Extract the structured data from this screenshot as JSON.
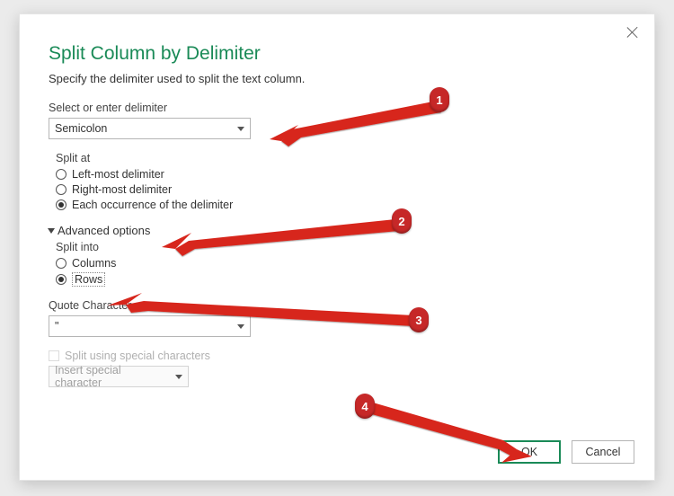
{
  "dialog": {
    "title": "Split Column by Delimiter",
    "subtitle": "Specify the delimiter used to split the text column."
  },
  "delimiter": {
    "label": "Select or enter delimiter",
    "value": "Semicolon"
  },
  "split_at": {
    "heading": "Split at",
    "options": {
      "left": "Left-most delimiter",
      "right": "Right-most delimiter",
      "each": "Each occurrence of the delimiter"
    },
    "selected": "each"
  },
  "advanced": {
    "toggle": "Advanced options",
    "split_into": {
      "heading": "Split into",
      "options": {
        "columns": "Columns",
        "rows": "Rows"
      },
      "selected": "rows"
    },
    "quote": {
      "label": "Quote Character",
      "value": "\""
    },
    "special": {
      "checkbox_label": "Split using special characters",
      "button_label": "Insert special character"
    }
  },
  "buttons": {
    "ok": "OK",
    "cancel": "Cancel"
  },
  "annotations": {
    "b1": "1",
    "b2": "2",
    "b3": "3",
    "b4": "4"
  }
}
